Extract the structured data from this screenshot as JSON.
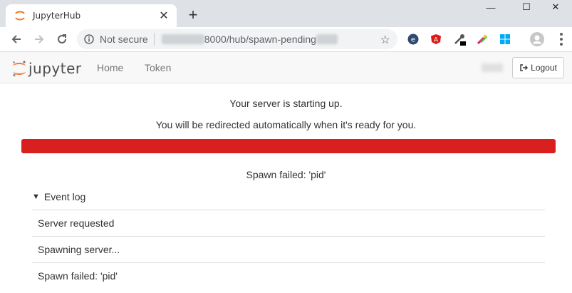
{
  "browser": {
    "tab_title": "JupyterHub",
    "tab_close": "✕",
    "new_tab": "+",
    "window_controls": {
      "minimize": "—",
      "maximize": "☐",
      "close": "✕"
    },
    "security_label": "Not secure",
    "url_visible": "8000/hub/spawn-pending",
    "star": "☆"
  },
  "header": {
    "logo_text": "jupyter",
    "nav": [
      {
        "label": "Home"
      },
      {
        "label": "Token"
      }
    ],
    "logout_label": "Logout"
  },
  "main": {
    "starting_message": "Your server is starting up.",
    "redirect_message": "You will be redirected automatically when it's ready for you.",
    "progress": {
      "percent": 100,
      "color": "#d9201e"
    },
    "status_message": "Spawn failed: 'pid'",
    "event_log": {
      "caret": "▼",
      "label": "Event log",
      "items": [
        "Server requested",
        "Spawning server...",
        "Spawn failed: 'pid'"
      ]
    }
  },
  "colors": {
    "jupyter_orange": "#f37726",
    "progress_danger": "#d9201e"
  }
}
